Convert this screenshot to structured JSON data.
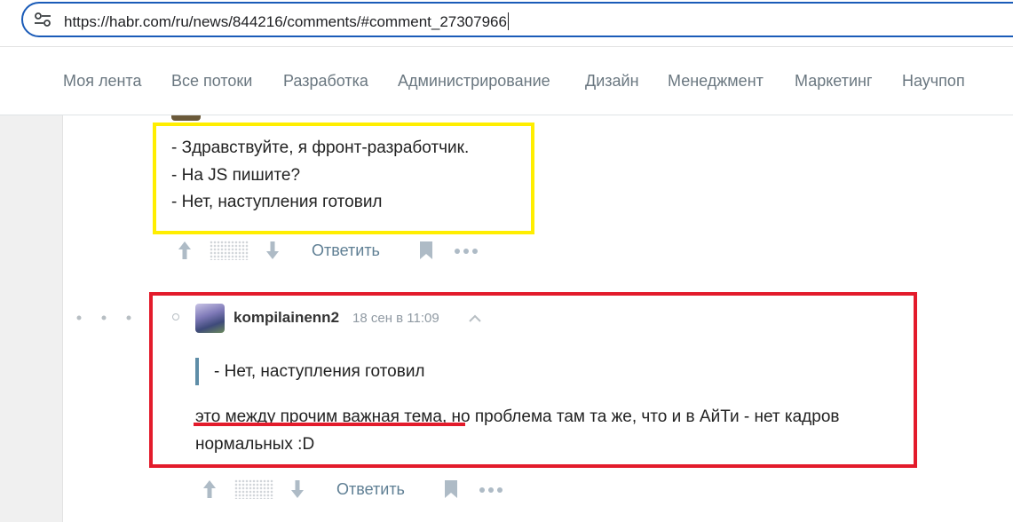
{
  "browser": {
    "url": "https://habr.com/ru/news/844216/comments/#comment_27307966",
    "site_icon": "site-settings-icon"
  },
  "nav": {
    "items": [
      {
        "label": "Моя лента"
      },
      {
        "label": "Все потоки"
      },
      {
        "label": "Разработка"
      },
      {
        "label": "Администрирование"
      },
      {
        "label": "Дизайн"
      },
      {
        "label": "Менеджмент"
      },
      {
        "label": "Маркетинг"
      },
      {
        "label": "Научпоп"
      }
    ]
  },
  "comments": [
    {
      "lines": [
        "- Здравствуйте, я фронт-разработчик.",
        "- На JS пишите?",
        "- Нет, наступления готовил"
      ],
      "actions": {
        "reply_label": "Ответить"
      },
      "highlight_color": "#ffee00"
    },
    {
      "username": "kompilainenn2",
      "timestamp": "18 сен в 11:09",
      "quote": "- Нет, наступления готовил",
      "body_underlined": "это между прочим важная тема",
      "body_rest": ", но проблема там та же, что и в АйТи - нет кадров нормальных :D",
      "actions": {
        "reply_label": "Ответить"
      },
      "highlight_color": "#e31b2b"
    }
  ],
  "colors": {
    "accent_link": "#5f7f94",
    "quote_bar": "#5e8da7"
  }
}
